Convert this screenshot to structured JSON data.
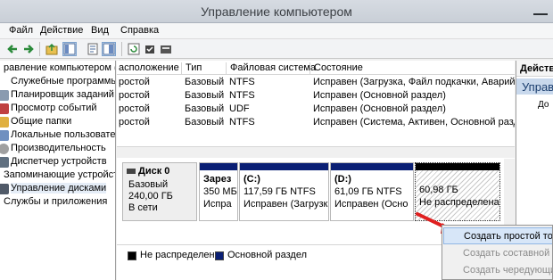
{
  "window": {
    "title": "Управление компьютером"
  },
  "menu": [
    "Файл",
    "Действие",
    "Вид",
    "Справка"
  ],
  "tree": {
    "root": "равление компьютером (л",
    "items": [
      "Служебные программы",
      "Планировщик заданий",
      "Просмотр событий",
      "Общие папки",
      "Локальные пользовател",
      "Производительность",
      "Диспетчер устройств",
      "Запоминающие устройства",
      "Управление дисками",
      "Службы и приложения"
    ]
  },
  "volumes": {
    "headers": [
      "асположение",
      "Тип",
      "Файловая система",
      "Состояние"
    ],
    "rows": [
      [
        "ростой",
        "Базовый",
        "NTFS",
        "Исправен (Загрузка, Файл подкачки, Аварийный"
      ],
      [
        "ростой",
        "Базовый",
        "NTFS",
        "Исправен (Основной раздел)"
      ],
      [
        "ростой",
        "Базовый",
        "UDF",
        "Исправен (Основной раздел)"
      ],
      [
        "ростой",
        "Базовый",
        "NTFS",
        "Исправен (Система, Активен, Основной раздел)"
      ]
    ]
  },
  "disk": {
    "name": "Диск 0",
    "type": "Базовый",
    "size": "240,00 ГБ",
    "status": "В сети"
  },
  "partitions": [
    {
      "l1": "Зарез",
      "l2": "350 МБ",
      "l3": "Испра"
    },
    {
      "l1": "(C:)",
      "l2": "117,59 ГБ NTFS",
      "l3": "Исправен (Загрузк"
    },
    {
      "l1": "(D:)",
      "l2": "61,09 ГБ NTFS",
      "l3": "Исправен (Осно"
    },
    {
      "l1": "60,98 ГБ",
      "l2": "Не распределена"
    }
  ],
  "legend": [
    {
      "label": "Не распределена",
      "color": "#000000"
    },
    {
      "label": "Основной раздел",
      "color": "#0a1f74"
    }
  ],
  "actions": {
    "header": "Действ",
    "section": "Управ",
    "item": "До"
  },
  "context_menu": [
    {
      "label": "Создать простой том...",
      "state": "highlighted"
    },
    {
      "label": "Создать составной том",
      "state": "disabled"
    },
    {
      "label": "Создать чередующий",
      "state": "disabled"
    }
  ],
  "colors": {
    "primary_partition": "#0a1f74",
    "unallocated": "#000000",
    "highlight": "#d7e6f8",
    "arrow": "#e02020"
  }
}
